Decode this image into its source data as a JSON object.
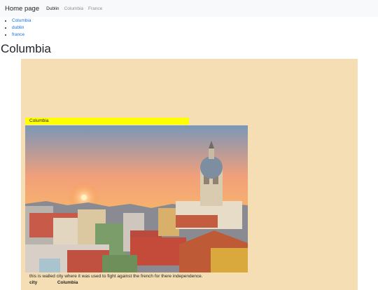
{
  "navbar": {
    "brand": "Home page",
    "links": [
      "Dublin",
      "Columbia",
      "France"
    ]
  },
  "links_list": [
    "Columbia",
    "dublin",
    "france"
  ],
  "page_title": "Columbia",
  "card": {
    "caption": "Columbia",
    "image_alt": "Cartagena walled city at sunset with cathedral dome",
    "description": "this is walled city where it was used to fight against the french for there independence.",
    "info_label": "city",
    "info_value": "Columbia"
  },
  "colors": {
    "panel_bg": "#f5deb3",
    "caption_bg": "#ffff00",
    "link": "#1a73e8",
    "navbar_bg": "#f8f9fa"
  }
}
